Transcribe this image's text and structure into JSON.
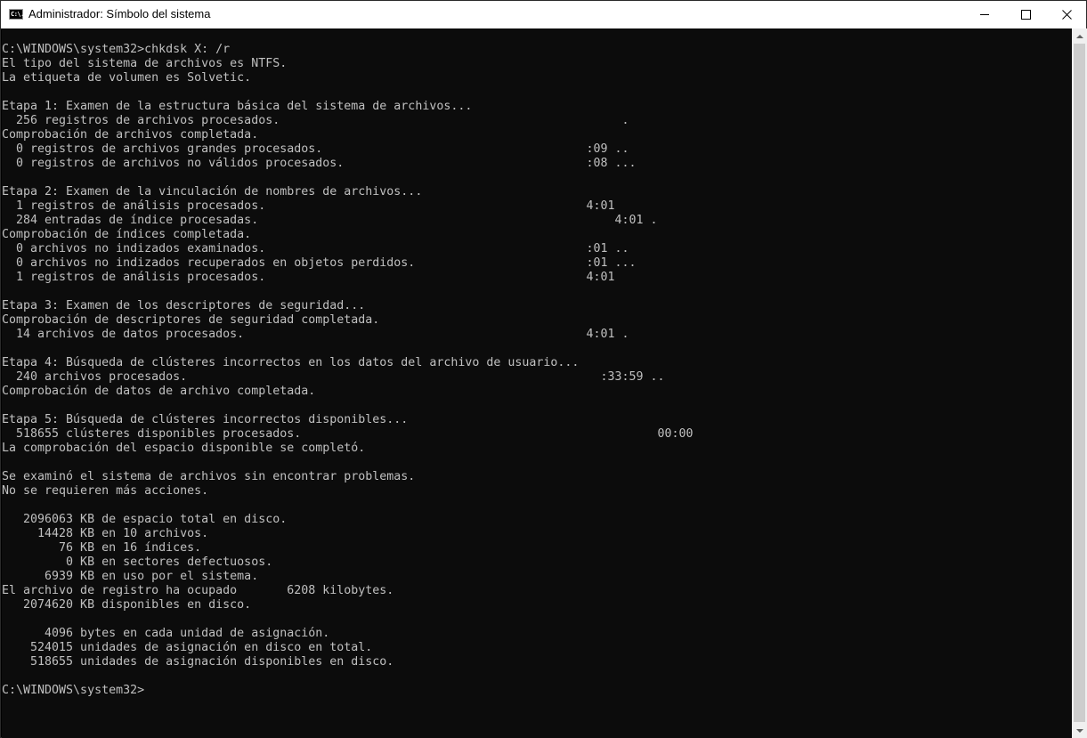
{
  "window": {
    "title": "Administrador: Símbolo del sistema",
    "icon": "cmd-icon",
    "controls": [
      "minimize-icon",
      "maximize-icon",
      "close-icon"
    ]
  },
  "console": {
    "lines": [
      "C:\\WINDOWS\\system32>chkdsk X: /r",
      "El tipo del sistema de archivos es NTFS.",
      "La etiqueta de volumen es Solvetic.",
      "",
      "Etapa 1: Examen de la estructura básica del sistema de archivos...",
      "  256 registros de archivos procesados.                                                .",
      "Comprobación de archivos completada.",
      "  0 registros de archivos grandes procesados.                                     :09 ..",
      "  0 registros de archivos no válidos procesados.                                  :08 ...",
      "",
      "Etapa 2: Examen de la vinculación de nombres de archivos...",
      "  1 registros de análisis procesados.                                             4:01",
      "  284 entradas de índice procesadas.                                                  4:01 .",
      "Comprobación de índices completada.",
      "  0 archivos no indizados examinados.                                             :01 ..",
      "  0 archivos no indizados recuperados en objetos perdidos.                        :01 ...",
      "  1 registros de análisis procesados.                                             4:01",
      "",
      "Etapa 3: Examen de los descriptores de seguridad...",
      "Comprobación de descriptores de seguridad completada.",
      "  14 archivos de datos procesados.                                                4:01 .",
      "",
      "Etapa 4: Búsqueda de clústeres incorrectos en los datos del archivo de usuario...",
      "  240 archivos procesados.                                                          :33:59 ..",
      "Comprobación de datos de archivo completada.",
      "",
      "Etapa 5: Búsqueda de clústeres incorrectos disponibles...",
      "  518655 clústeres disponibles procesados.                                                  00:00",
      "La comprobación del espacio disponible se completó.",
      "",
      "Se examinó el sistema de archivos sin encontrar problemas.",
      "No se requieren más acciones.",
      "",
      "   2096063 KB de espacio total en disco.",
      "     14428 KB en 10 archivos.",
      "        76 KB en 16 índices.",
      "         0 KB en sectores defectuosos.",
      "      6939 KB en uso por el sistema.",
      "El archivo de registro ha ocupado       6208 kilobytes.",
      "   2074620 KB disponibles en disco.",
      "",
      "      4096 bytes en cada unidad de asignación.",
      "    524015 unidades de asignación en disco en total.",
      "    518655 unidades de asignación disponibles en disco.",
      "",
      "C:\\WINDOWS\\system32>"
    ]
  },
  "icon_glyph": "C:\\.",
  "scrollbar": {
    "up": "chevron-up-icon",
    "down": "chevron-down-icon"
  }
}
